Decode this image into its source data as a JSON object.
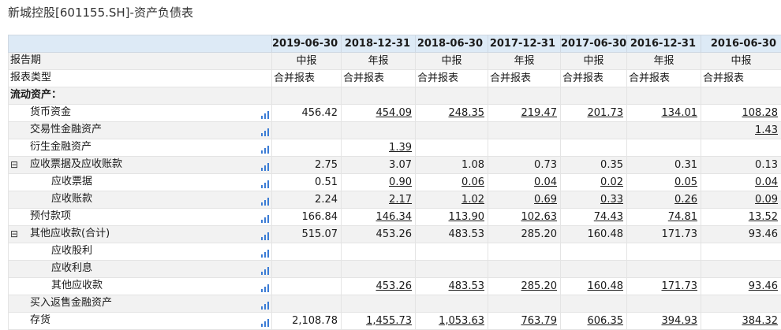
{
  "page": {
    "title": "新城控股[601155.SH]-资产负债表"
  },
  "table": {
    "dates": [
      "2019-06-30",
      "2018-12-31",
      "2018-06-30",
      "2017-12-31",
      "2017-06-30",
      "2016-12-31",
      "2016-06-30"
    ],
    "rows": [
      {
        "label": "报告期",
        "indent": 0,
        "kind": "center",
        "values": [
          "中报",
          "年报",
          "中报",
          "年报",
          "中报",
          "年报",
          "中报"
        ]
      },
      {
        "label": "报表类型",
        "indent": 0,
        "kind": "left",
        "values": [
          "合并报表",
          "合并报表",
          "合并报表",
          "合并报表",
          "合并报表",
          "合并报表",
          "合并报表"
        ]
      },
      {
        "label": "流动资产：",
        "indent": 0,
        "kind": "section",
        "values": [
          "",
          "",
          "",
          "",
          "",
          "",
          ""
        ]
      },
      {
        "label": "货币资金",
        "indent": 1,
        "kind": "num",
        "chart": true,
        "values": [
          "456.42",
          "454.09",
          "248.35",
          "219.47",
          "201.73",
          "134.01",
          "108.28"
        ],
        "links": [
          false,
          true,
          true,
          true,
          true,
          true,
          true
        ]
      },
      {
        "label": "交易性金融资产",
        "indent": 1,
        "kind": "num",
        "chart": true,
        "values": [
          "",
          "",
          "",
          "",
          "",
          "",
          "1.43"
        ],
        "links": [
          false,
          false,
          false,
          false,
          false,
          false,
          true
        ]
      },
      {
        "label": "衍生金融资产",
        "indent": 1,
        "kind": "num",
        "chart": true,
        "values": [
          "",
          "1.39",
          "",
          "",
          "",
          "",
          ""
        ],
        "links": [
          false,
          true,
          false,
          false,
          false,
          false,
          false
        ]
      },
      {
        "label": "应收票据及应收账款",
        "indent": 1,
        "kind": "num",
        "chart": true,
        "toggle": "⊟",
        "values": [
          "2.75",
          "3.07",
          "1.08",
          "0.73",
          "0.35",
          "0.31",
          "0.13"
        ],
        "links": [
          false,
          false,
          false,
          false,
          false,
          false,
          false
        ]
      },
      {
        "label": "应收票据",
        "indent": 2,
        "kind": "num",
        "chart": true,
        "values": [
          "0.51",
          "0.90",
          "0.06",
          "0.04",
          "0.02",
          "0.05",
          "0.04"
        ],
        "links": [
          false,
          true,
          true,
          true,
          true,
          true,
          true
        ]
      },
      {
        "label": "应收账款",
        "indent": 2,
        "kind": "num",
        "chart": true,
        "values": [
          "2.24",
          "2.17",
          "1.02",
          "0.69",
          "0.33",
          "0.26",
          "0.09"
        ],
        "links": [
          false,
          true,
          true,
          true,
          true,
          true,
          true
        ]
      },
      {
        "label": "预付款项",
        "indent": 1,
        "kind": "num",
        "chart": true,
        "values": [
          "166.84",
          "146.34",
          "113.90",
          "102.63",
          "74.43",
          "74.81",
          "13.52"
        ],
        "links": [
          false,
          true,
          true,
          true,
          true,
          true,
          true
        ]
      },
      {
        "label": "其他应收款(合计)",
        "indent": 1,
        "kind": "num",
        "chart": true,
        "toggle": "⊟",
        "values": [
          "515.07",
          "453.26",
          "483.53",
          "285.20",
          "160.48",
          "171.73",
          "93.46"
        ],
        "links": [
          false,
          false,
          false,
          false,
          false,
          false,
          false
        ]
      },
      {
        "label": "应收股利",
        "indent": 2,
        "kind": "num",
        "chart": true,
        "values": [
          "",
          "",
          "",
          "",
          "",
          "",
          ""
        ],
        "links": [
          false,
          false,
          false,
          false,
          false,
          false,
          false
        ]
      },
      {
        "label": "应收利息",
        "indent": 2,
        "kind": "num",
        "chart": true,
        "values": [
          "",
          "",
          "",
          "",
          "",
          "",
          ""
        ],
        "links": [
          false,
          false,
          false,
          false,
          false,
          false,
          false
        ]
      },
      {
        "label": "其他应收款",
        "indent": 2,
        "kind": "num",
        "chart": true,
        "values": [
          "",
          "453.26",
          "483.53",
          "285.20",
          "160.48",
          "171.73",
          "93.46"
        ],
        "links": [
          false,
          true,
          true,
          true,
          true,
          true,
          true
        ]
      },
      {
        "label": "买入返售金融资产",
        "indent": 1,
        "kind": "num",
        "chart": true,
        "values": [
          "",
          "",
          "",
          "",
          "",
          "",
          ""
        ],
        "links": [
          false,
          false,
          false,
          false,
          false,
          false,
          false
        ]
      },
      {
        "label": "存货",
        "indent": 1,
        "kind": "num",
        "chart": true,
        "values": [
          "2,108.78",
          "1,455.73",
          "1,053.63",
          "763.79",
          "606.35",
          "394.93",
          "384.32"
        ],
        "links": [
          false,
          true,
          true,
          true,
          true,
          true,
          true
        ]
      }
    ]
  },
  "colors": {
    "header_bg": "#ddeaf6",
    "alt_row_bg": "#f2f2f2",
    "icon_blue": "#3a7bd5"
  },
  "icons": {
    "chart": "bar-chart-icon",
    "toggle": "collapse-icon"
  }
}
